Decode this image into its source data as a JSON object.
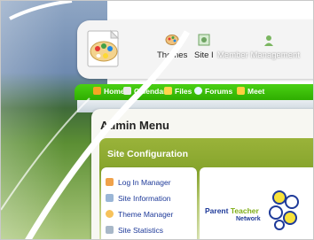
{
  "toolbar": {
    "tools": [
      {
        "label": "Themes",
        "icon": "themes-icon"
      },
      {
        "label": "Site I",
        "icon": "site-info-icon"
      },
      {
        "label": "Member Management",
        "icon": "member-management-icon"
      }
    ]
  },
  "nav": {
    "items": [
      {
        "label": "Home",
        "icon": "home-icon",
        "color": "#f5a623"
      },
      {
        "label": "Calendar",
        "icon": "calendar-icon",
        "color": "#e9e9e9"
      },
      {
        "label": "Files",
        "icon": "files-icon",
        "color": "#ffd54a"
      },
      {
        "label": "Forums",
        "icon": "forums-icon",
        "color": "#e6f7ff"
      },
      {
        "label": "Meet",
        "icon": "meetings-icon",
        "color": "#ffcf3f"
      }
    ]
  },
  "admin": {
    "title": "Admin Menu",
    "section_title": "Site Configuration",
    "menu": [
      {
        "label": "Log In Manager",
        "icon": "login-manager-icon",
        "color": "#f0a24a"
      },
      {
        "label": "Site Information",
        "icon": "site-information-icon",
        "color": "#9ab6d6"
      },
      {
        "label": "Theme Manager",
        "icon": "theme-manager-icon",
        "color": "#f7c25a"
      },
      {
        "label": "Site Statistics",
        "icon": "site-statistics-icon",
        "color": "#a8b8c8"
      }
    ]
  },
  "logo": {
    "word1": "Parent",
    "word2": "Teacher",
    "word3": "Network",
    "color1": "#1e3a99",
    "color2": "#7fae17"
  },
  "colors": {
    "nav_green": "#2fae00",
    "section_green": "#86a42c",
    "link_blue": "#1e3a99"
  }
}
